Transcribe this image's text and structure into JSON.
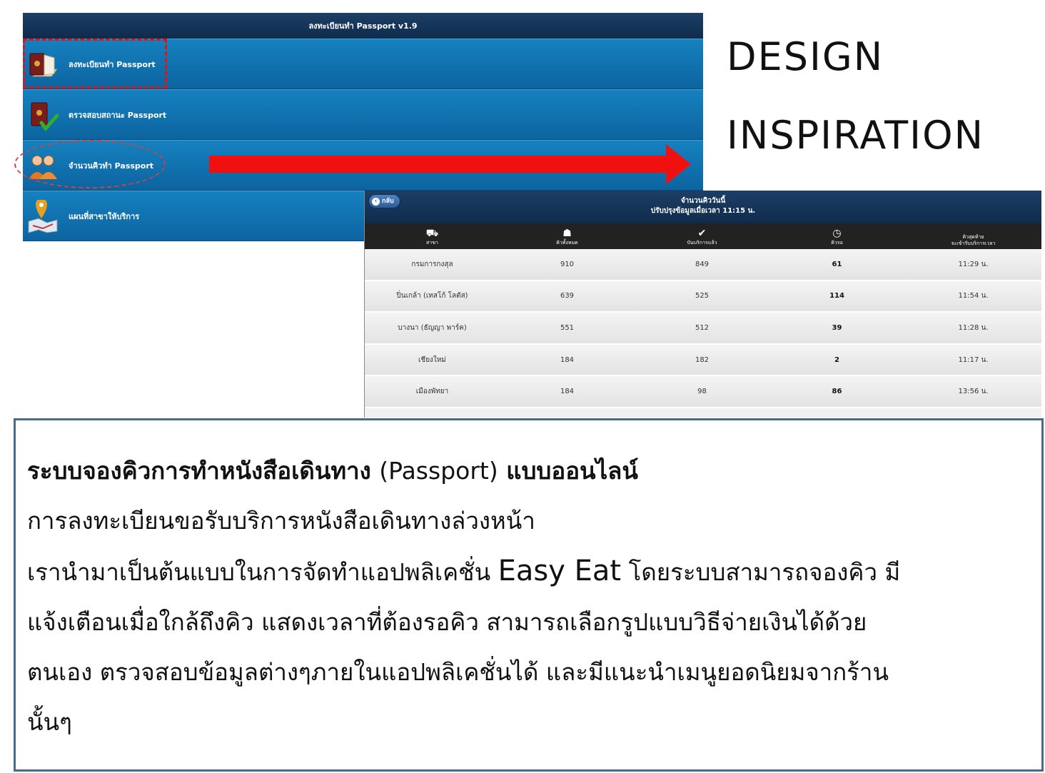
{
  "heading": {
    "line1": "DESIGN",
    "line2": "INSPIRATION"
  },
  "menu_app": {
    "title": "ลงทะเบียนทำ Passport v1.9",
    "items": [
      {
        "label": "ลงทะเบียนทำ Passport",
        "icon": "passport-book-icon"
      },
      {
        "label": "ตรวจสอบสถานะ Passport",
        "icon": "passport-check-icon"
      },
      {
        "label": "จำนวนคิวทำ Passport",
        "icon": "people-icon"
      },
      {
        "label": "แผนที่สาขาให้บริการ",
        "icon": "map-pin-icon"
      }
    ]
  },
  "queue_app": {
    "back_label": "กลับ",
    "title": "จำนวนคิววันนี้",
    "subtitle": "ปรับปรุงข้อมูลเมื่อเวลา 11:15 น.",
    "columns": [
      {
        "label": "สาขา",
        "icon": "branch-icon"
      },
      {
        "label": "คิวทั้งหมด",
        "icon": "group-icon"
      },
      {
        "label": "บันบริการแล้ว",
        "icon": "user-check-icon"
      },
      {
        "label": "คิวรอ",
        "icon": "clock-icon"
      },
      {
        "label": "คิวสุดท้าย\nจะเข้ารับบริการเวลา",
        "icon": ""
      }
    ],
    "rows": [
      {
        "branch": "กรมการกงสุล",
        "total": "910",
        "served": "849",
        "waiting": "61",
        "last_time": "11:29 น."
      },
      {
        "branch": "ปิ่นเกล้า (เทสโก้ โลตัส)",
        "total": "639",
        "served": "525",
        "waiting": "114",
        "last_time": "11:54 น."
      },
      {
        "branch": "บางนา (ธัญญา พาร์ค)",
        "total": "551",
        "served": "512",
        "waiting": "39",
        "last_time": "11:28 น."
      },
      {
        "branch": "เชียงใหม่",
        "total": "184",
        "served": "182",
        "waiting": "2",
        "last_time": "11:17 น."
      },
      {
        "branch": "เมืองพัทยา",
        "total": "184",
        "served": "98",
        "waiting": "86",
        "last_time": "13:56 น."
      }
    ]
  },
  "description": {
    "headline_a": "ระบบจองคิวการทำหนังสือเดินทาง",
    "headline_b": "(Passport)",
    "headline_c": "แบบออนไลน์",
    "line2": "การลงทะเบียนขอรับบริการหนังสือเดินทางล่วงหน้า",
    "line3_a": "เรานำมาเป็นต้นแบบในการจัดทำแอปพลิเคชั่น",
    "line3_brand": "Easy Eat",
    "line3_b": "โดยระบบสามารถจองคิว มี",
    "line4": "แจ้งเตือนเมื่อใกล้ถึงคิว แสดงเวลาที่ต้องรอคิว สามารถเลือกรูปแบบวิธีจ่ายเงินได้ด้วย",
    "line5": "ตนเอง ตรวจสอบข้อมูลต่างๆภายในแอปพลิเคชั่นได้ และมีแนะนำเมนูยอดนิยมจากร้าน",
    "line6": "นั้นๆ"
  }
}
